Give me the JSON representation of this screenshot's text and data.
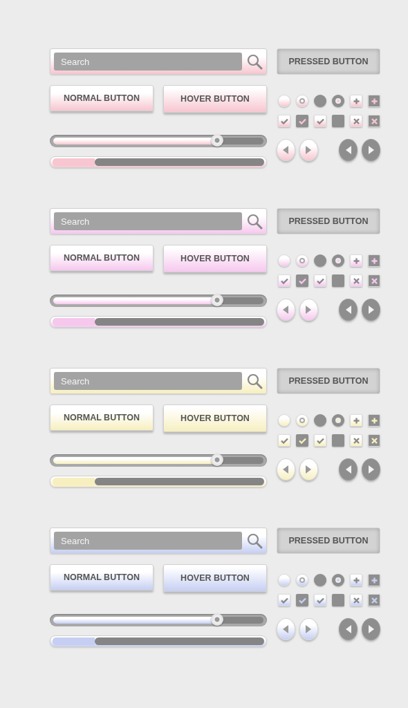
{
  "kits": [
    {
      "color": "#f7c6d0",
      "search": {
        "placeholder": "Search"
      },
      "pressed_button": {
        "label": "PRESSED BUTTON"
      },
      "buttons": [
        {
          "label": "NORMAL BUTTON",
          "kind": "normal"
        },
        {
          "label": "HOVER BUTTON",
          "kind": "hover"
        }
      ],
      "toggles": [
        {
          "kind": "radio",
          "checked": false
        },
        {
          "kind": "radio",
          "checked": true
        },
        {
          "kind": "radio",
          "checked": false
        },
        {
          "kind": "radio",
          "checked": true
        },
        {
          "kind": "plus"
        },
        {
          "kind": "plus"
        },
        {
          "kind": "checkbox",
          "checked": true
        },
        {
          "kind": "checkbox",
          "checked": true
        },
        {
          "kind": "checkbox",
          "checked": true
        },
        {
          "kind": "checkbox",
          "checked": false
        },
        {
          "kind": "cross"
        },
        {
          "kind": "cross"
        }
      ],
      "slider": {
        "level": 0.78
      },
      "progress": {
        "level": 0.2
      }
    },
    {
      "color": "#f6c8ee",
      "search": {
        "placeholder": "Search"
      },
      "pressed_button": {
        "label": "PRESSED BUTTON"
      },
      "buttons": [
        {
          "label": "NORMAL BUTTON",
          "kind": "normal"
        },
        {
          "label": "HOVER BUTTON",
          "kind": "hover"
        }
      ],
      "toggles": [
        {
          "kind": "radio",
          "checked": false
        },
        {
          "kind": "radio",
          "checked": true
        },
        {
          "kind": "radio",
          "checked": false
        },
        {
          "kind": "radio",
          "checked": true
        },
        {
          "kind": "plus"
        },
        {
          "kind": "plus"
        },
        {
          "kind": "checkbox",
          "checked": true
        },
        {
          "kind": "checkbox",
          "checked": true
        },
        {
          "kind": "checkbox",
          "checked": true
        },
        {
          "kind": "checkbox",
          "checked": false
        },
        {
          "kind": "cross"
        },
        {
          "kind": "cross"
        }
      ],
      "slider": {
        "level": 0.78
      },
      "progress": {
        "level": 0.2
      }
    },
    {
      "color": "#f7efbf",
      "search": {
        "placeholder": "Search"
      },
      "pressed_button": {
        "label": "PRESSED BUTTON"
      },
      "buttons": [
        {
          "label": "NORMAL BUTTON",
          "kind": "normal"
        },
        {
          "label": "HOVER BUTTON",
          "kind": "hover"
        }
      ],
      "toggles": [
        {
          "kind": "radio",
          "checked": false
        },
        {
          "kind": "radio",
          "checked": true
        },
        {
          "kind": "radio",
          "checked": false
        },
        {
          "kind": "radio",
          "checked": true
        },
        {
          "kind": "plus"
        },
        {
          "kind": "plus"
        },
        {
          "kind": "checkbox",
          "checked": true
        },
        {
          "kind": "checkbox",
          "checked": true
        },
        {
          "kind": "checkbox",
          "checked": true
        },
        {
          "kind": "checkbox",
          "checked": false
        },
        {
          "kind": "cross"
        },
        {
          "kind": "cross"
        }
      ],
      "slider": {
        "level": 0.78
      },
      "progress": {
        "level": 0.2
      }
    },
    {
      "color": "#c6cff3",
      "search": {
        "placeholder": "Search"
      },
      "pressed_button": {
        "label": "PRESSED BUTTON"
      },
      "buttons": [
        {
          "label": "NORMAL BUTTON",
          "kind": "normal"
        },
        {
          "label": "HOVER BUTTON",
          "kind": "hover"
        }
      ],
      "toggles": [
        {
          "kind": "radio",
          "checked": false
        },
        {
          "kind": "radio",
          "checked": true
        },
        {
          "kind": "radio",
          "checked": false
        },
        {
          "kind": "radio",
          "checked": true
        },
        {
          "kind": "plus"
        },
        {
          "kind": "plus"
        },
        {
          "kind": "checkbox",
          "checked": true
        },
        {
          "kind": "checkbox",
          "checked": true
        },
        {
          "kind": "checkbox",
          "checked": true
        },
        {
          "kind": "checkbox",
          "checked": false
        },
        {
          "kind": "cross"
        },
        {
          "kind": "cross"
        }
      ],
      "slider": {
        "level": 0.78
      },
      "progress": {
        "level": 0.2
      }
    }
  ]
}
